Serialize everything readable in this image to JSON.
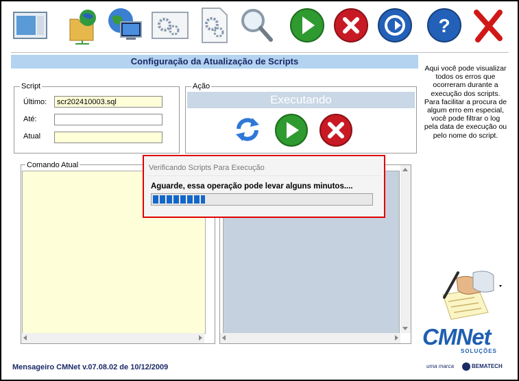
{
  "toolbar": {
    "items": [
      {
        "name": "window-icon",
        "label": ""
      },
      {
        "name": "folder-network-icon",
        "label": ""
      },
      {
        "name": "globe-computer-icon",
        "label": ""
      },
      {
        "name": "settings-window-icon",
        "label": ""
      },
      {
        "name": "settings-document-icon",
        "label": ""
      },
      {
        "name": "magnifier-icon",
        "label": ""
      },
      {
        "name": "play-icon",
        "label": ""
      },
      {
        "name": "stop-icon",
        "label": ""
      },
      {
        "name": "exit-icon",
        "label": ""
      },
      {
        "name": "help-icon",
        "label": ""
      },
      {
        "name": "close-icon",
        "label": ""
      }
    ]
  },
  "header": {
    "title": "Configuração da Atualização de Scripts"
  },
  "help_text": "Aqui você pode visualizar todos os erros que ocorreram durante a execução dos scripts. Para facilitar a procura de algum erro em especial, você pode filtrar o log pela data de execução ou pelo nome do script.",
  "script_group": {
    "legend": "Script",
    "ultimo_label": "Último:",
    "ultimo_value": "scr202410003.sql",
    "ate_label": "Até:",
    "ate_value": "",
    "atual_label": "Atual",
    "atual_value": ""
  },
  "action_group": {
    "legend": "Ação",
    "status": "Executando"
  },
  "command_panel": {
    "legend": "Comando Atual"
  },
  "dialog": {
    "title": "Verificando Scripts Para Execução",
    "message": "Aguarde, essa operação pode levar alguns minutos....",
    "progress": 0.24
  },
  "footer": {
    "version": "Mensageiro CMNet v.07.08.02 de 10/12/2009"
  },
  "logo": {
    "main": "CMNet",
    "sub": "SOLUÇÕES",
    "tag": "uma marca",
    "brand": "BEMATECH"
  },
  "colors": {
    "title_bg": "#b3d3f1",
    "title_text": "#1a2a66",
    "input_yellow": "#fefed8",
    "right_panel": "#c5d1de",
    "dialog_border": "#e00000",
    "progress": "#1467c9"
  }
}
